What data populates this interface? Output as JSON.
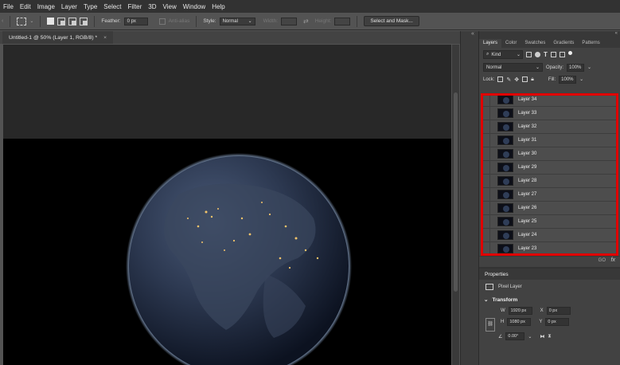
{
  "menu": [
    "File",
    "Edit",
    "Image",
    "Layer",
    "Type",
    "Select",
    "Filter",
    "3D",
    "View",
    "Window",
    "Help"
  ],
  "options": {
    "feather_label": "Feather:",
    "feather_value": "0 px",
    "antialias_label": "Anti-alias",
    "style_label": "Style:",
    "style_value": "Normal",
    "width_label": "Width:",
    "height_label": "Height:",
    "select_mask_label": "Select and Mask..."
  },
  "document": {
    "tab_title": "Untitled-1 @ 50% (Layer 1, RGB/8) *",
    "close_glyph": "×"
  },
  "panel": {
    "collapse_glyph": "«",
    "tabs": [
      "Layers",
      "Color",
      "Swatches",
      "Gradients",
      "Patterns"
    ],
    "kind_label": "Kind",
    "blend_mode": "Normal",
    "opacity_label": "Opacity:",
    "opacity_value": "100%",
    "lock_label": "Lock:",
    "fill_label": "Fill:",
    "fill_value": "100%",
    "layers": [
      "Layer 34",
      "Layer 33",
      "Layer 32",
      "Layer 31",
      "Layer 30",
      "Layer 29",
      "Layer 28",
      "Layer 27",
      "Layer 26",
      "Layer 25",
      "Layer 24",
      "Layer 23"
    ],
    "footer_link": "GO",
    "footer_fx": "fx"
  },
  "properties": {
    "title": "Properties",
    "pixel_layer": "Pixel Layer",
    "transform_title": "Transform",
    "w_label": "W",
    "w_value": "1920 px",
    "h_label": "H",
    "h_value": "1080 px",
    "x_label": "X",
    "x_value": "0 px",
    "y_label": "Y",
    "y_value": "0 px",
    "angle_value": "0.00°"
  },
  "colors": {
    "highlight": "#e00000",
    "app_bg": "#535353",
    "panel_bg": "#424242"
  }
}
